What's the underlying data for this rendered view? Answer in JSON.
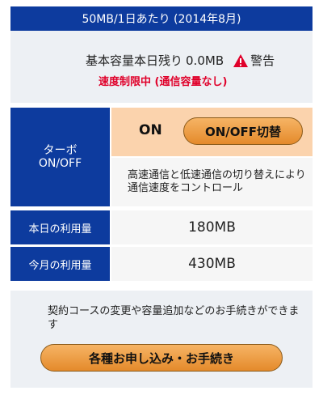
{
  "header": {
    "plan_text": "50MB/1日あたり (2014年8月)"
  },
  "remaining": {
    "basic_capacity_label": "基本容量本日残り",
    "remaining_value": "0.0MB",
    "warning_label": "警告",
    "limit_notice": "速度制限中 (通信容量なし)"
  },
  "turbo": {
    "label_line1": "ターボ",
    "label_line2": "ON/OFF",
    "state": "ON",
    "toggle_button_label": "ON/OFF切替",
    "description": "高速通信と低速通信の切り替えにより通信速度をコントロール"
  },
  "usage": {
    "today_label": "本日の利用量",
    "today_value": "180MB",
    "month_label": "今月の利用量",
    "month_value": "430MB"
  },
  "procedures": {
    "description": "契約コースの変更や容量追加などのお手続きができます",
    "button_label": "各種お申し込み・お手続き"
  },
  "colors": {
    "header_blue": "#0d3b9e",
    "panel_gray": "#edf0f4",
    "warning_red": "#e0002a",
    "button_orange": "#f0a04b",
    "toggle_cell_peach": "#fbd3ad"
  }
}
